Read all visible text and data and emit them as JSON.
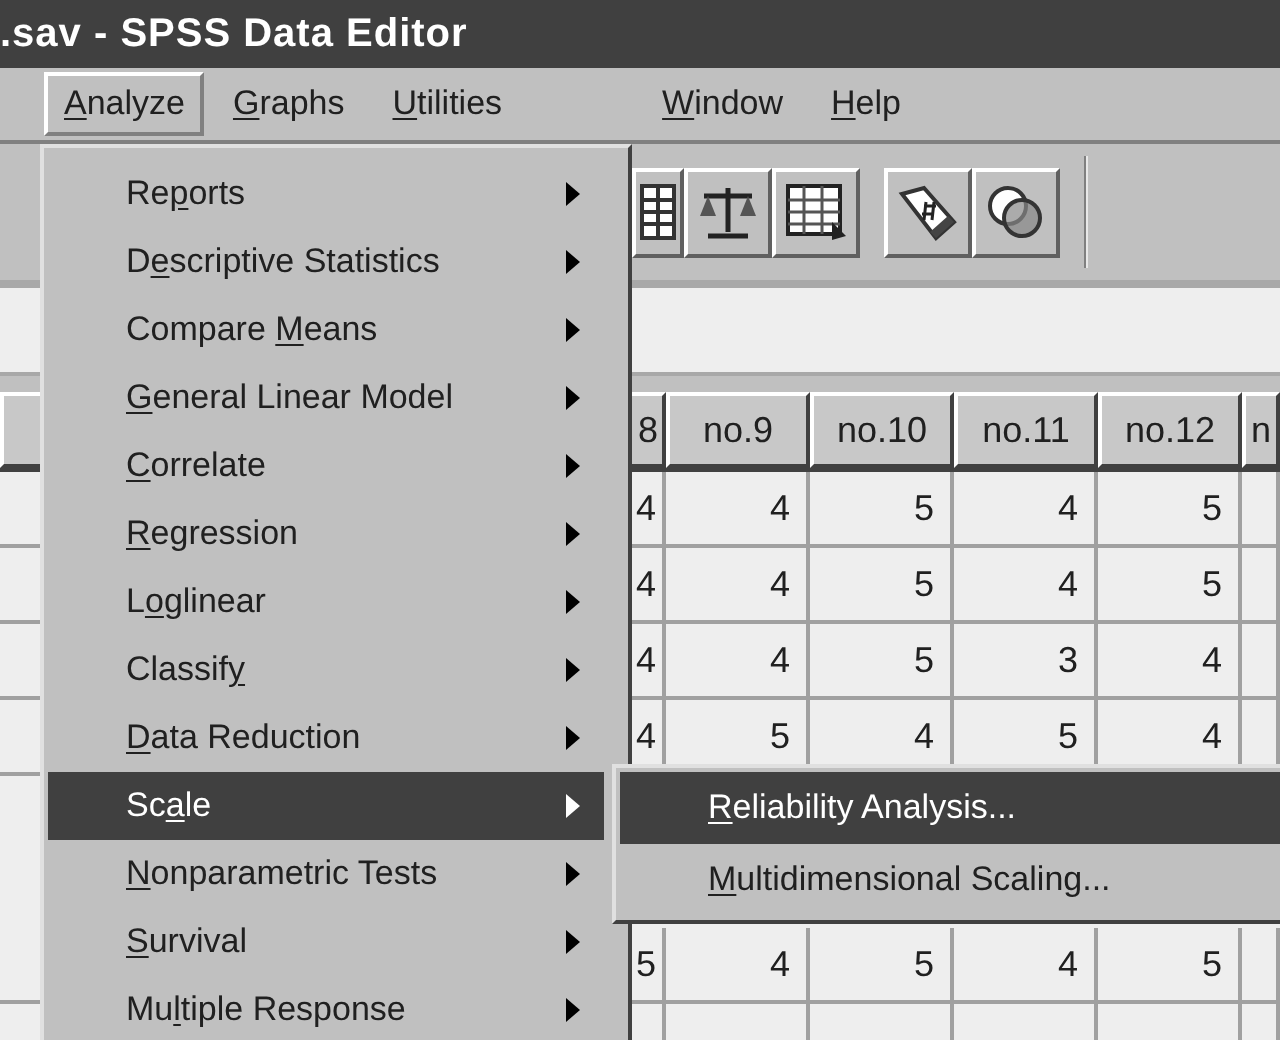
{
  "window": {
    "title": ".sav - SPSS Data Editor"
  },
  "menu_bar": [
    {
      "key": "A",
      "post": "nalyze",
      "selected": true
    },
    {
      "key": "G",
      "post": "raphs",
      "selected": false
    },
    {
      "key": "U",
      "post": "tilities",
      "selected": false
    },
    {
      "key": "W",
      "post": "indow",
      "selected": false
    },
    {
      "key": "H",
      "post": "elp",
      "selected": false
    }
  ],
  "analyze_menu": [
    {
      "pre": "Re",
      "key": "p",
      "post": "orts",
      "selected": false
    },
    {
      "pre": "D",
      "key": "e",
      "post": "scriptive Statistics",
      "selected": false
    },
    {
      "pre": "Compare ",
      "key": "M",
      "post": "eans",
      "selected": false
    },
    {
      "key": "G",
      "post": "eneral Linear Model",
      "selected": false
    },
    {
      "key": "C",
      "post": "orrelate",
      "selected": false
    },
    {
      "key": "R",
      "post": "egression",
      "selected": false
    },
    {
      "pre": "L",
      "key": "o",
      "post": "glinear",
      "selected": false
    },
    {
      "pre": "Classif",
      "key": "y",
      "selected": false
    },
    {
      "key": "D",
      "post": "ata Reduction",
      "selected": false
    },
    {
      "pre": "Sc",
      "key": "a",
      "post": "le",
      "selected": true
    },
    {
      "key": "N",
      "post": "onparametric Tests",
      "selected": false
    },
    {
      "key": "S",
      "post": "urvival",
      "selected": false
    },
    {
      "pre": "Mu",
      "key": "l",
      "post": "tiple Response",
      "selected": false
    }
  ],
  "scale_submenu": [
    {
      "key": "R",
      "post": "eliability Analysis...",
      "selected": true
    },
    {
      "key": "M",
      "post": "ultidimensional Scaling...",
      "selected": false
    }
  ],
  "table": {
    "columns": [
      "8",
      "no.9",
      "no.10",
      "no.11",
      "no.12",
      "n"
    ],
    "rows_above_submenu": [
      [
        "4",
        "4",
        "5",
        "4",
        "5"
      ],
      [
        "4",
        "4",
        "5",
        "4",
        "5"
      ],
      [
        "4",
        "4",
        "5",
        "3",
        "4"
      ],
      [
        "4",
        "5",
        "4",
        "5",
        "4"
      ]
    ],
    "rows_below_submenu": [
      [
        "5",
        "4",
        "5",
        "4",
        "5"
      ]
    ]
  }
}
